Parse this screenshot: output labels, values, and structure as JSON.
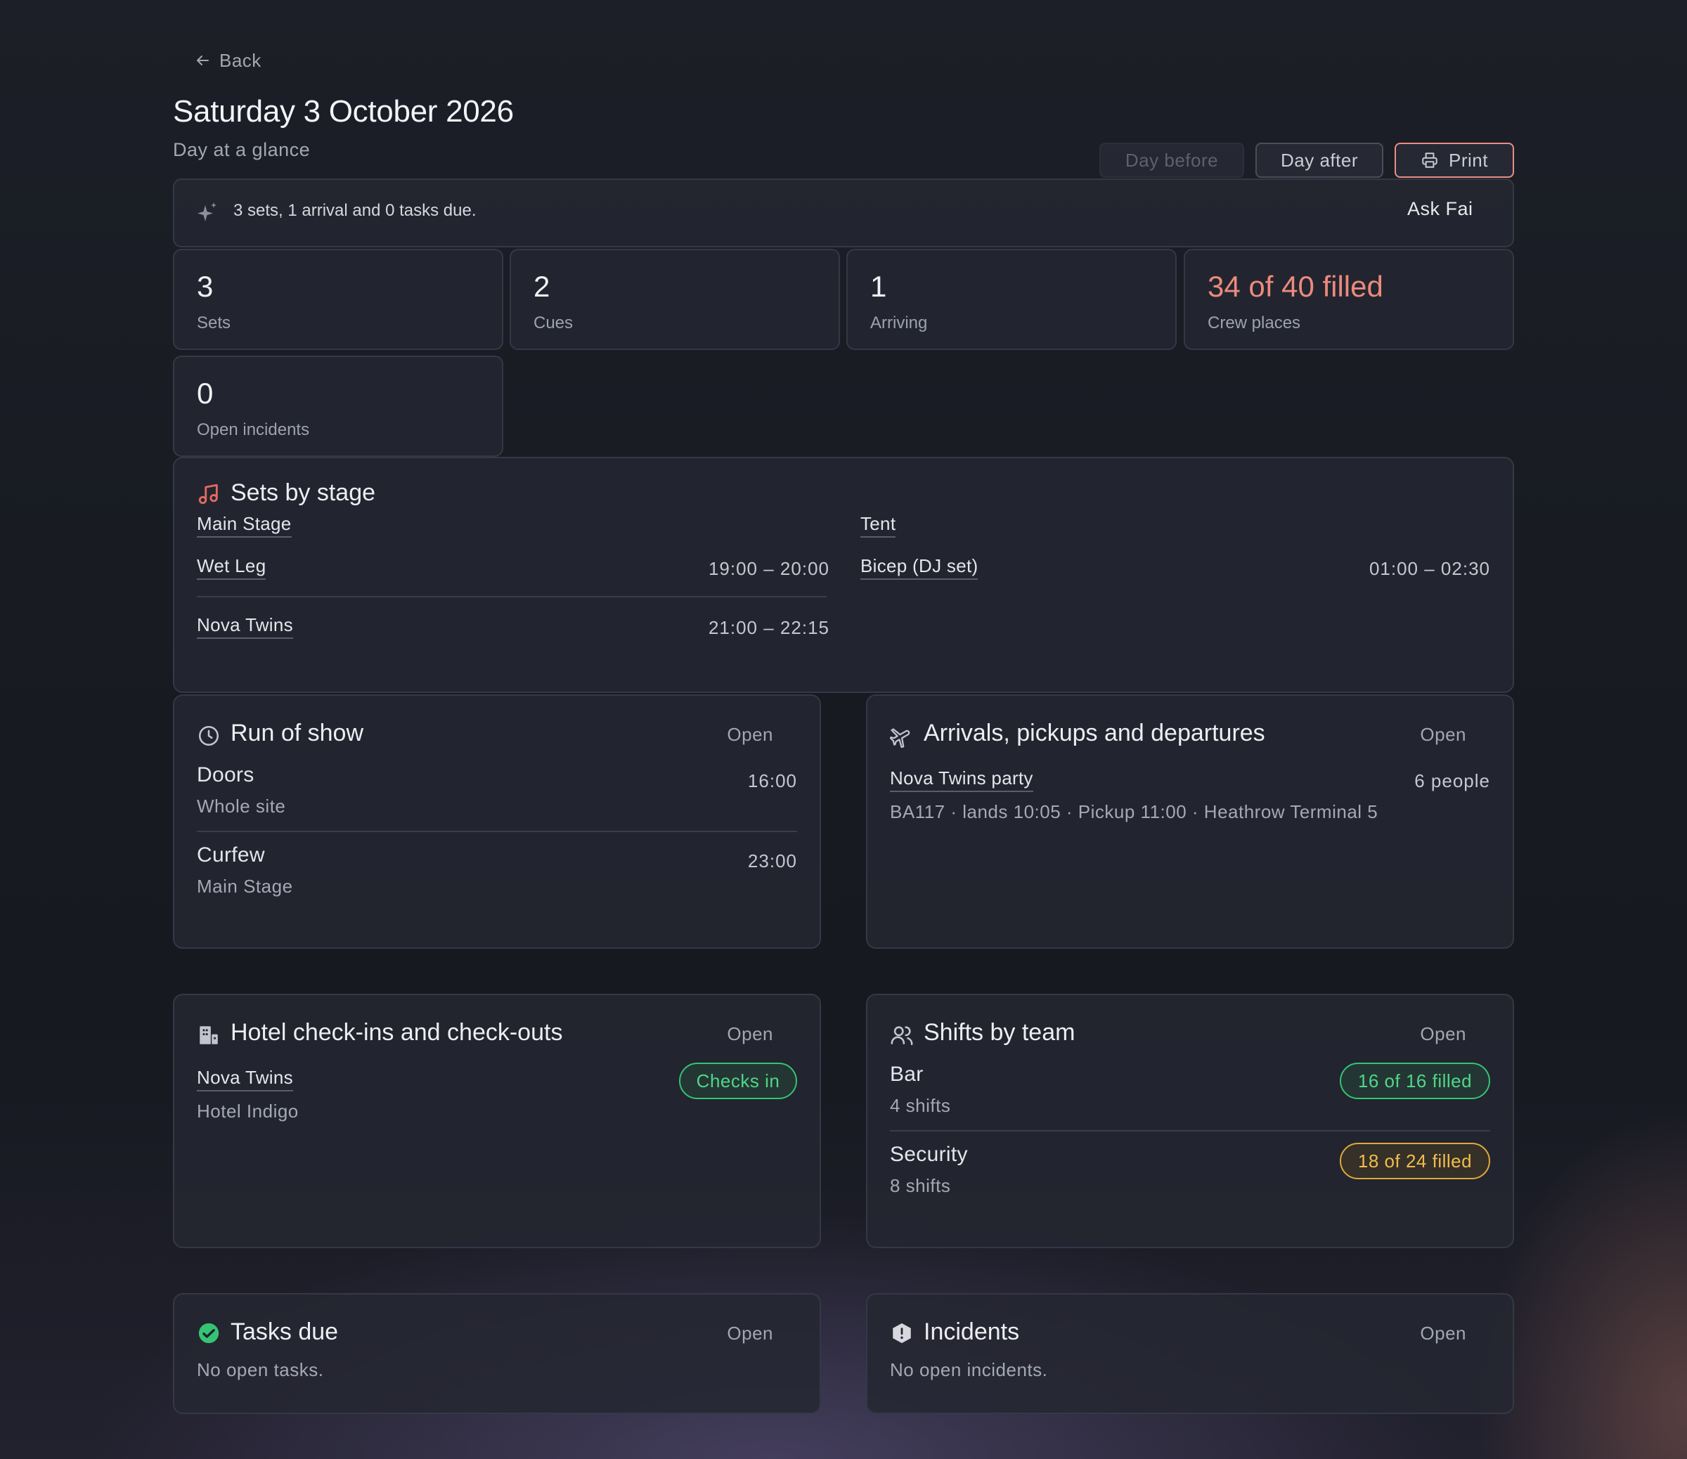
{
  "nav": {
    "back_label": "Back"
  },
  "header": {
    "title": "Saturday 3 October 2026",
    "subtitle": "Day at a glance",
    "day_before_label": "Day before",
    "day_after_label": "Day after",
    "print_label": "Print"
  },
  "summary": {
    "text": "3 sets, 1 arrival and 0 tasks due.",
    "ask_label": "Ask Fai"
  },
  "stats": [
    {
      "value": "3",
      "label": "Sets"
    },
    {
      "value": "2",
      "label": "Cues"
    },
    {
      "value": "1",
      "label": "Arriving"
    },
    {
      "value": "34 of 40 filled",
      "label": "Crew places"
    },
    {
      "value": "0",
      "label": "Open incidents"
    }
  ],
  "sets_by_stage": {
    "title": "Sets by stage",
    "stages": [
      {
        "name": "Main Stage",
        "sets": [
          {
            "artist": "Wet Leg",
            "time": "19:00 – 20:00"
          },
          {
            "artist": "Nova Twins",
            "time": "21:00 – 22:15"
          }
        ]
      },
      {
        "name": "Tent",
        "sets": [
          {
            "artist": "Bicep (DJ set)",
            "time": "01:00 – 02:30"
          }
        ]
      }
    ]
  },
  "run_of_show": {
    "title": "Run of show",
    "open_label": "Open",
    "items": [
      {
        "name": "Doors",
        "location": "Whole site",
        "time": "16:00"
      },
      {
        "name": "Curfew",
        "location": "Main Stage",
        "time": "23:00"
      }
    ]
  },
  "arrivals": {
    "title": "Arrivals, pickups and departures",
    "open_label": "Open",
    "items": [
      {
        "name": "Nova Twins party",
        "people": "6 people",
        "details": "BA117 · lands 10:05 · Pickup 11:00 · Heathrow Terminal 5"
      }
    ]
  },
  "hotels": {
    "title": "Hotel check-ins and check-outs",
    "open_label": "Open",
    "items": [
      {
        "name": "Nova Twins",
        "hotel": "Hotel Indigo",
        "status": "Checks in"
      }
    ]
  },
  "shifts": {
    "title": "Shifts by team",
    "open_label": "Open",
    "items": [
      {
        "team": "Bar",
        "shifts": "4 shifts",
        "filled": "16 of 16 filled",
        "status_color": "#34c474"
      },
      {
        "team": "Security",
        "shifts": "8 shifts",
        "filled": "18 of 24 filled",
        "status_color": "#e0a93a"
      }
    ]
  },
  "tasks": {
    "title": "Tasks due",
    "open_label": "Open",
    "empty_text": "No open tasks."
  },
  "incidents": {
    "title": "Incidents",
    "open_label": "Open",
    "empty_text": "No open incidents."
  },
  "colors": {
    "accent": "#ec8a7c",
    "success": "#34c474",
    "warning": "#e0a93a"
  },
  "icons": [
    "arrow-left-icon",
    "printer-icon",
    "sparkle-icon",
    "music-icon",
    "clock-icon",
    "plane-icon",
    "hotel-icon",
    "users-icon",
    "check-circle-icon",
    "alert-hexagon-icon"
  ]
}
